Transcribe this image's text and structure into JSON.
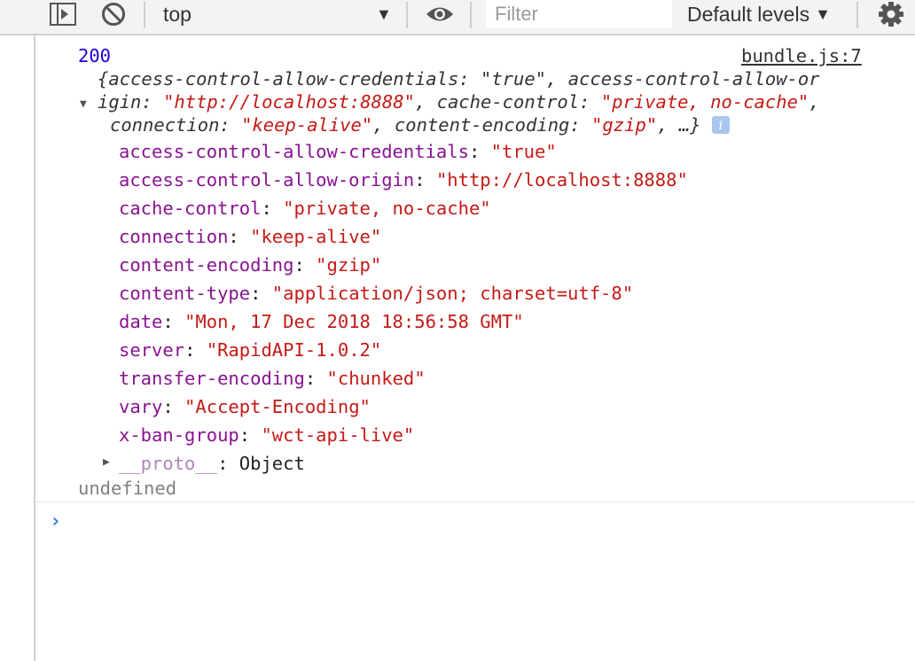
{
  "toolbar": {
    "context": "top",
    "filter_placeholder": "Filter",
    "levels": "Default levels"
  },
  "console": {
    "status_value": "200",
    "source_link": "bundle.js:7",
    "preview": {
      "line1": "{access-control-allow-credentials: \"true\", access-control-allow-or",
      "line2_prefix": "igin: ",
      "line2_v1": "\"http://localhost:8888\"",
      "line2_k2": "cache-control",
      "line2_v2": "\"private, no-cache\"",
      "line3_k1": "connection",
      "line3_v1": "\"keep-alive\"",
      "line3_k2": "content-encoding",
      "line3_v2": "\"gzip\"",
      "line3_tail": ", …}",
      "info": "i"
    },
    "headers": [
      {
        "key": "access-control-allow-credentials",
        "value": "\"true\""
      },
      {
        "key": "access-control-allow-origin",
        "value": "\"http://localhost:8888\""
      },
      {
        "key": "cache-control",
        "value": "\"private, no-cache\""
      },
      {
        "key": "connection",
        "value": "\"keep-alive\""
      },
      {
        "key": "content-encoding",
        "value": "\"gzip\""
      },
      {
        "key": "content-type",
        "value": "\"application/json; charset=utf-8\""
      },
      {
        "key": "date",
        "value": "\"Mon, 17 Dec 2018 18:56:58 GMT\""
      },
      {
        "key": "server",
        "value": "\"RapidAPI-1.0.2\""
      },
      {
        "key": "transfer-encoding",
        "value": "\"chunked\""
      },
      {
        "key": "vary",
        "value": "\"Accept-Encoding\""
      },
      {
        "key": "x-ban-group",
        "value": "\"wct-api-live\""
      }
    ],
    "proto_key": "__proto__",
    "proto_value": "Object",
    "return_value": "undefined",
    "prompt_symbol": "›"
  }
}
